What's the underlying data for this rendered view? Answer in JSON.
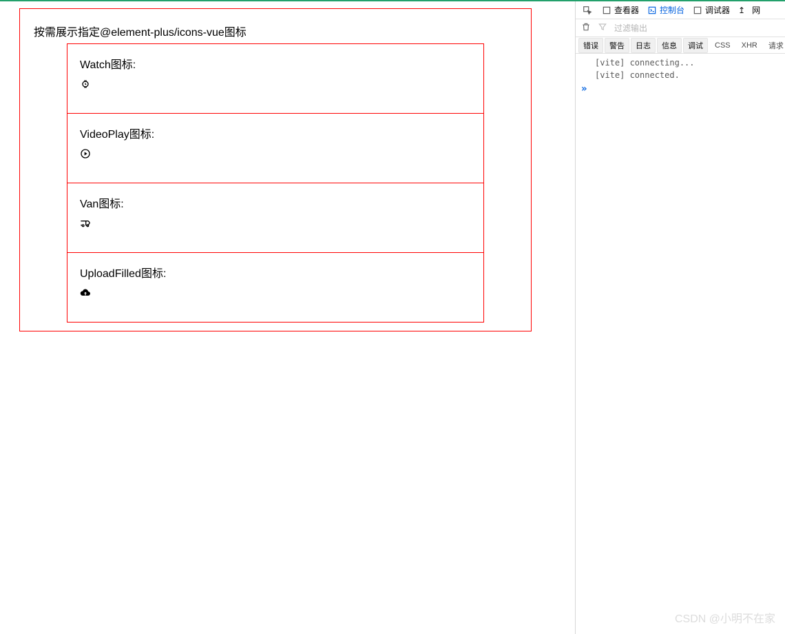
{
  "page": {
    "heading": "按需展示指定@element-plus/icons-vue图标",
    "blocks": [
      {
        "label": "Watch图标:",
        "icon": "watch-icon"
      },
      {
        "label": "VideoPlay图标:",
        "icon": "video-play-icon"
      },
      {
        "label": "Van图标:",
        "icon": "van-icon"
      },
      {
        "label": "UploadFilled图标:",
        "icon": "upload-filled-icon"
      }
    ]
  },
  "devtools": {
    "toolbar": {
      "picker_name": "element-picker",
      "tabs": {
        "inspector": "查看器",
        "console": "控制台",
        "debugger": "调试器",
        "network": "网"
      },
      "active_tab": "console",
      "arrow": "↥"
    },
    "filterbar": {
      "placeholder": "过滤输出"
    },
    "filters": {
      "error": "错误",
      "warning": "警告",
      "log": "日志",
      "info": "信息",
      "debug": "调试",
      "css": "CSS",
      "xhr": "XHR",
      "request": "请求"
    },
    "logs": [
      "[vite] connecting...",
      "[vite] connected."
    ],
    "expand_marker": "»"
  },
  "watermark": "CSDN @小明不在家"
}
